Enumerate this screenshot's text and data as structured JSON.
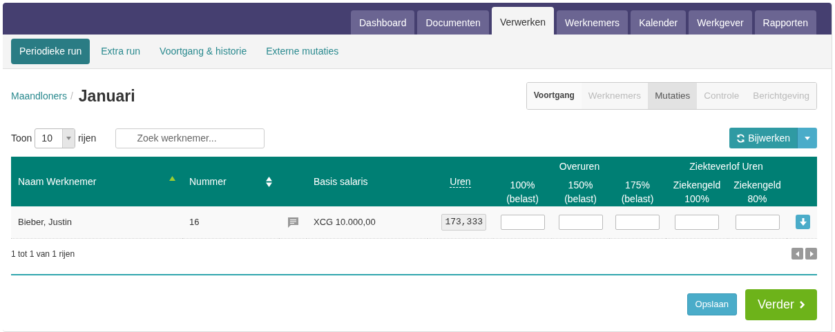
{
  "top_tabs": [
    {
      "label": "Dashboard",
      "selected": false
    },
    {
      "label": "Documenten",
      "selected": false
    },
    {
      "label": "Verwerken",
      "selected": true
    },
    {
      "label": "Werknemers",
      "selected": false
    },
    {
      "label": "Kalender",
      "selected": false
    },
    {
      "label": "Werkgever",
      "selected": false
    },
    {
      "label": "Rapporten",
      "selected": false
    }
  ],
  "sub_tabs": [
    {
      "label": "Periodieke run",
      "selected": true
    },
    {
      "label": "Extra run",
      "selected": false
    },
    {
      "label": "Voortgang & historie",
      "selected": false
    },
    {
      "label": "Externe mutaties",
      "selected": false
    }
  ],
  "breadcrumb": {
    "parent": "Maandloners",
    "separator": "/",
    "title": "Januari"
  },
  "steps": [
    {
      "kind": "heading",
      "label": "Voortgang"
    },
    {
      "kind": "step",
      "label": "Werknemers",
      "selected": false,
      "disabled": true
    },
    {
      "kind": "step",
      "label": "Mutaties",
      "selected": true,
      "disabled": false
    },
    {
      "kind": "step",
      "label": "Controle",
      "selected": false,
      "disabled": true
    },
    {
      "kind": "step",
      "label": "Berichtgeving",
      "selected": false,
      "disabled": true
    }
  ],
  "page_length": {
    "label_before": "Toon",
    "value": "10",
    "label_after": "rijen"
  },
  "search": {
    "placeholder": "Zoek werknemer..."
  },
  "update_button": {
    "label": "Bijwerken"
  },
  "table": {
    "columns": [
      {
        "kind": "text",
        "label": "Naam Werknemer",
        "sortable": true,
        "sorted": true
      },
      {
        "kind": "text",
        "label": "Nummer",
        "sortable": true,
        "sorted": false
      },
      {
        "kind": "blank"
      },
      {
        "kind": "text",
        "label": "Basis salaris"
      },
      {
        "kind": "abbr",
        "label": "Uren"
      },
      {
        "kind": "group",
        "label": "Overuren",
        "children": [
          {
            "lines": [
              "100%",
              "(belast)"
            ]
          },
          {
            "lines": [
              "150%",
              "(belast)"
            ]
          },
          {
            "lines": [
              "175%",
              "(belast)"
            ]
          }
        ]
      },
      {
        "kind": "group",
        "label": "Ziekteverlof Uren",
        "children": [
          {
            "lines": [
              "Ziekengeld",
              "100%"
            ]
          },
          {
            "lines": [
              "Ziekengeld",
              "80%"
            ]
          }
        ]
      },
      {
        "kind": "blank"
      }
    ],
    "rows": [
      {
        "name": "Bieber, Justin",
        "number": "16",
        "salary": "XCG 10.000,00",
        "hours": "173,333"
      }
    ]
  },
  "info": "1 tot 1 van 1 rijen",
  "save_button": {
    "label": "Opslaan"
  },
  "next_button": {
    "label": "Verder"
  }
}
